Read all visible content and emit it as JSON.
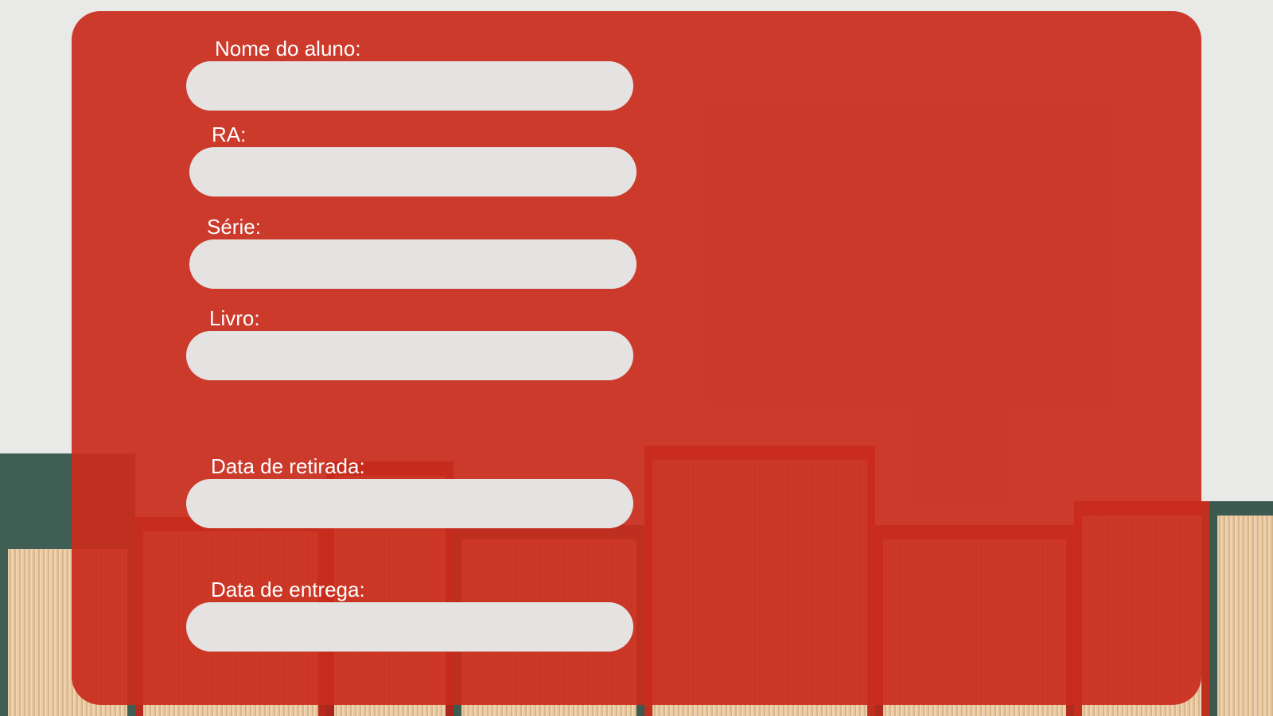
{
  "form": {
    "fields": [
      {
        "id": "nome",
        "label": "Nome do aluno:",
        "value": "",
        "placeholder": ""
      },
      {
        "id": "ra",
        "label": "RA:",
        "value": "",
        "placeholder": ""
      },
      {
        "id": "serie",
        "label": "Série:",
        "value": "",
        "placeholder": ""
      },
      {
        "id": "livro",
        "label": "Livro:",
        "value": "",
        "placeholder": ""
      },
      {
        "id": "retirada",
        "label": "Data de retirada:",
        "value": "",
        "placeholder": ""
      },
      {
        "id": "entrega",
        "label": "Data de entrega:",
        "value": "",
        "placeholder": ""
      }
    ]
  },
  "colors": {
    "card": "#c92c1c",
    "input_bg": "#e4e3e2",
    "label_text": "#ffffff",
    "page_bg": "#e9e9e8"
  }
}
